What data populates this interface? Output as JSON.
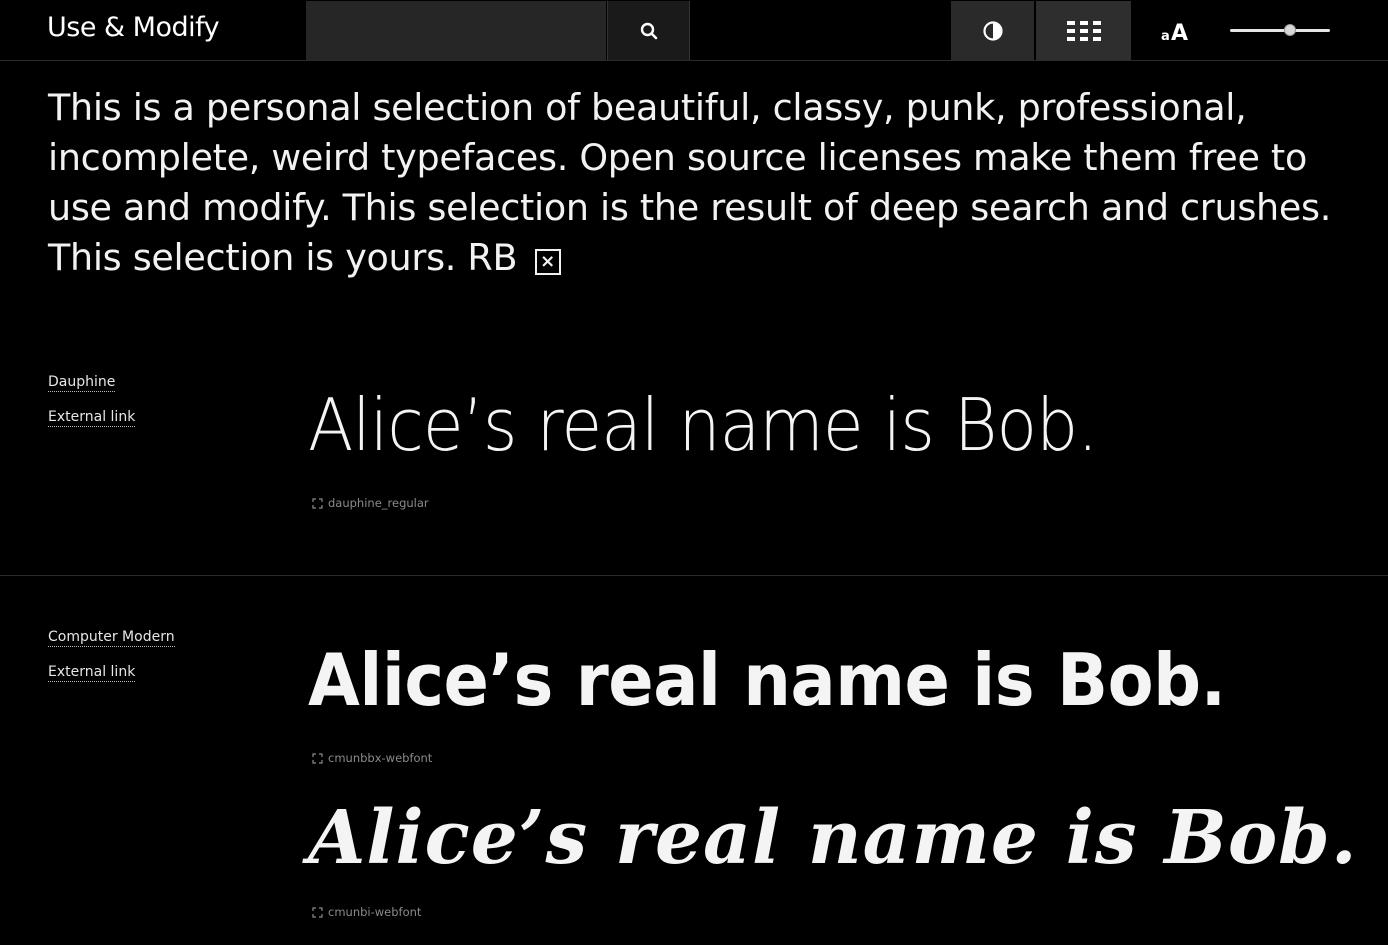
{
  "header": {
    "logo": "Use & Modify",
    "search_placeholder": "",
    "icons": {
      "search": "search-icon",
      "contrast": "contrast-icon",
      "grid": "grid-icon",
      "text_size": "text-size-icon"
    },
    "size_slider_level": 0.6
  },
  "intro": {
    "text": "This is a personal selection of beautiful, classy, punk, professional, incomplete, weird typefaces. Open source licenses make them free to use and modify. This selection is the result of deep search and crushes. This selection is yours. RB",
    "close_glyph": "×"
  },
  "fonts": [
    {
      "name": "Dauphine",
      "link_label": "External link",
      "samples": [
        {
          "text": "Alice’s real name is Bob.",
          "file": "dauphine_regular"
        }
      ]
    },
    {
      "name": "Computer Modern",
      "link_label": "External link",
      "samples": [
        {
          "text": "Alice’s real name is Bob.",
          "file": "cmunbbx-webfont"
        },
        {
          "text": "Alice’s real name is Bob.",
          "file": "cmunbi-webfont"
        }
      ]
    }
  ],
  "colors": {
    "background": "#000000",
    "text": "#f2f2f2",
    "muted": "#8a8a8a",
    "search_field": "#262626"
  }
}
